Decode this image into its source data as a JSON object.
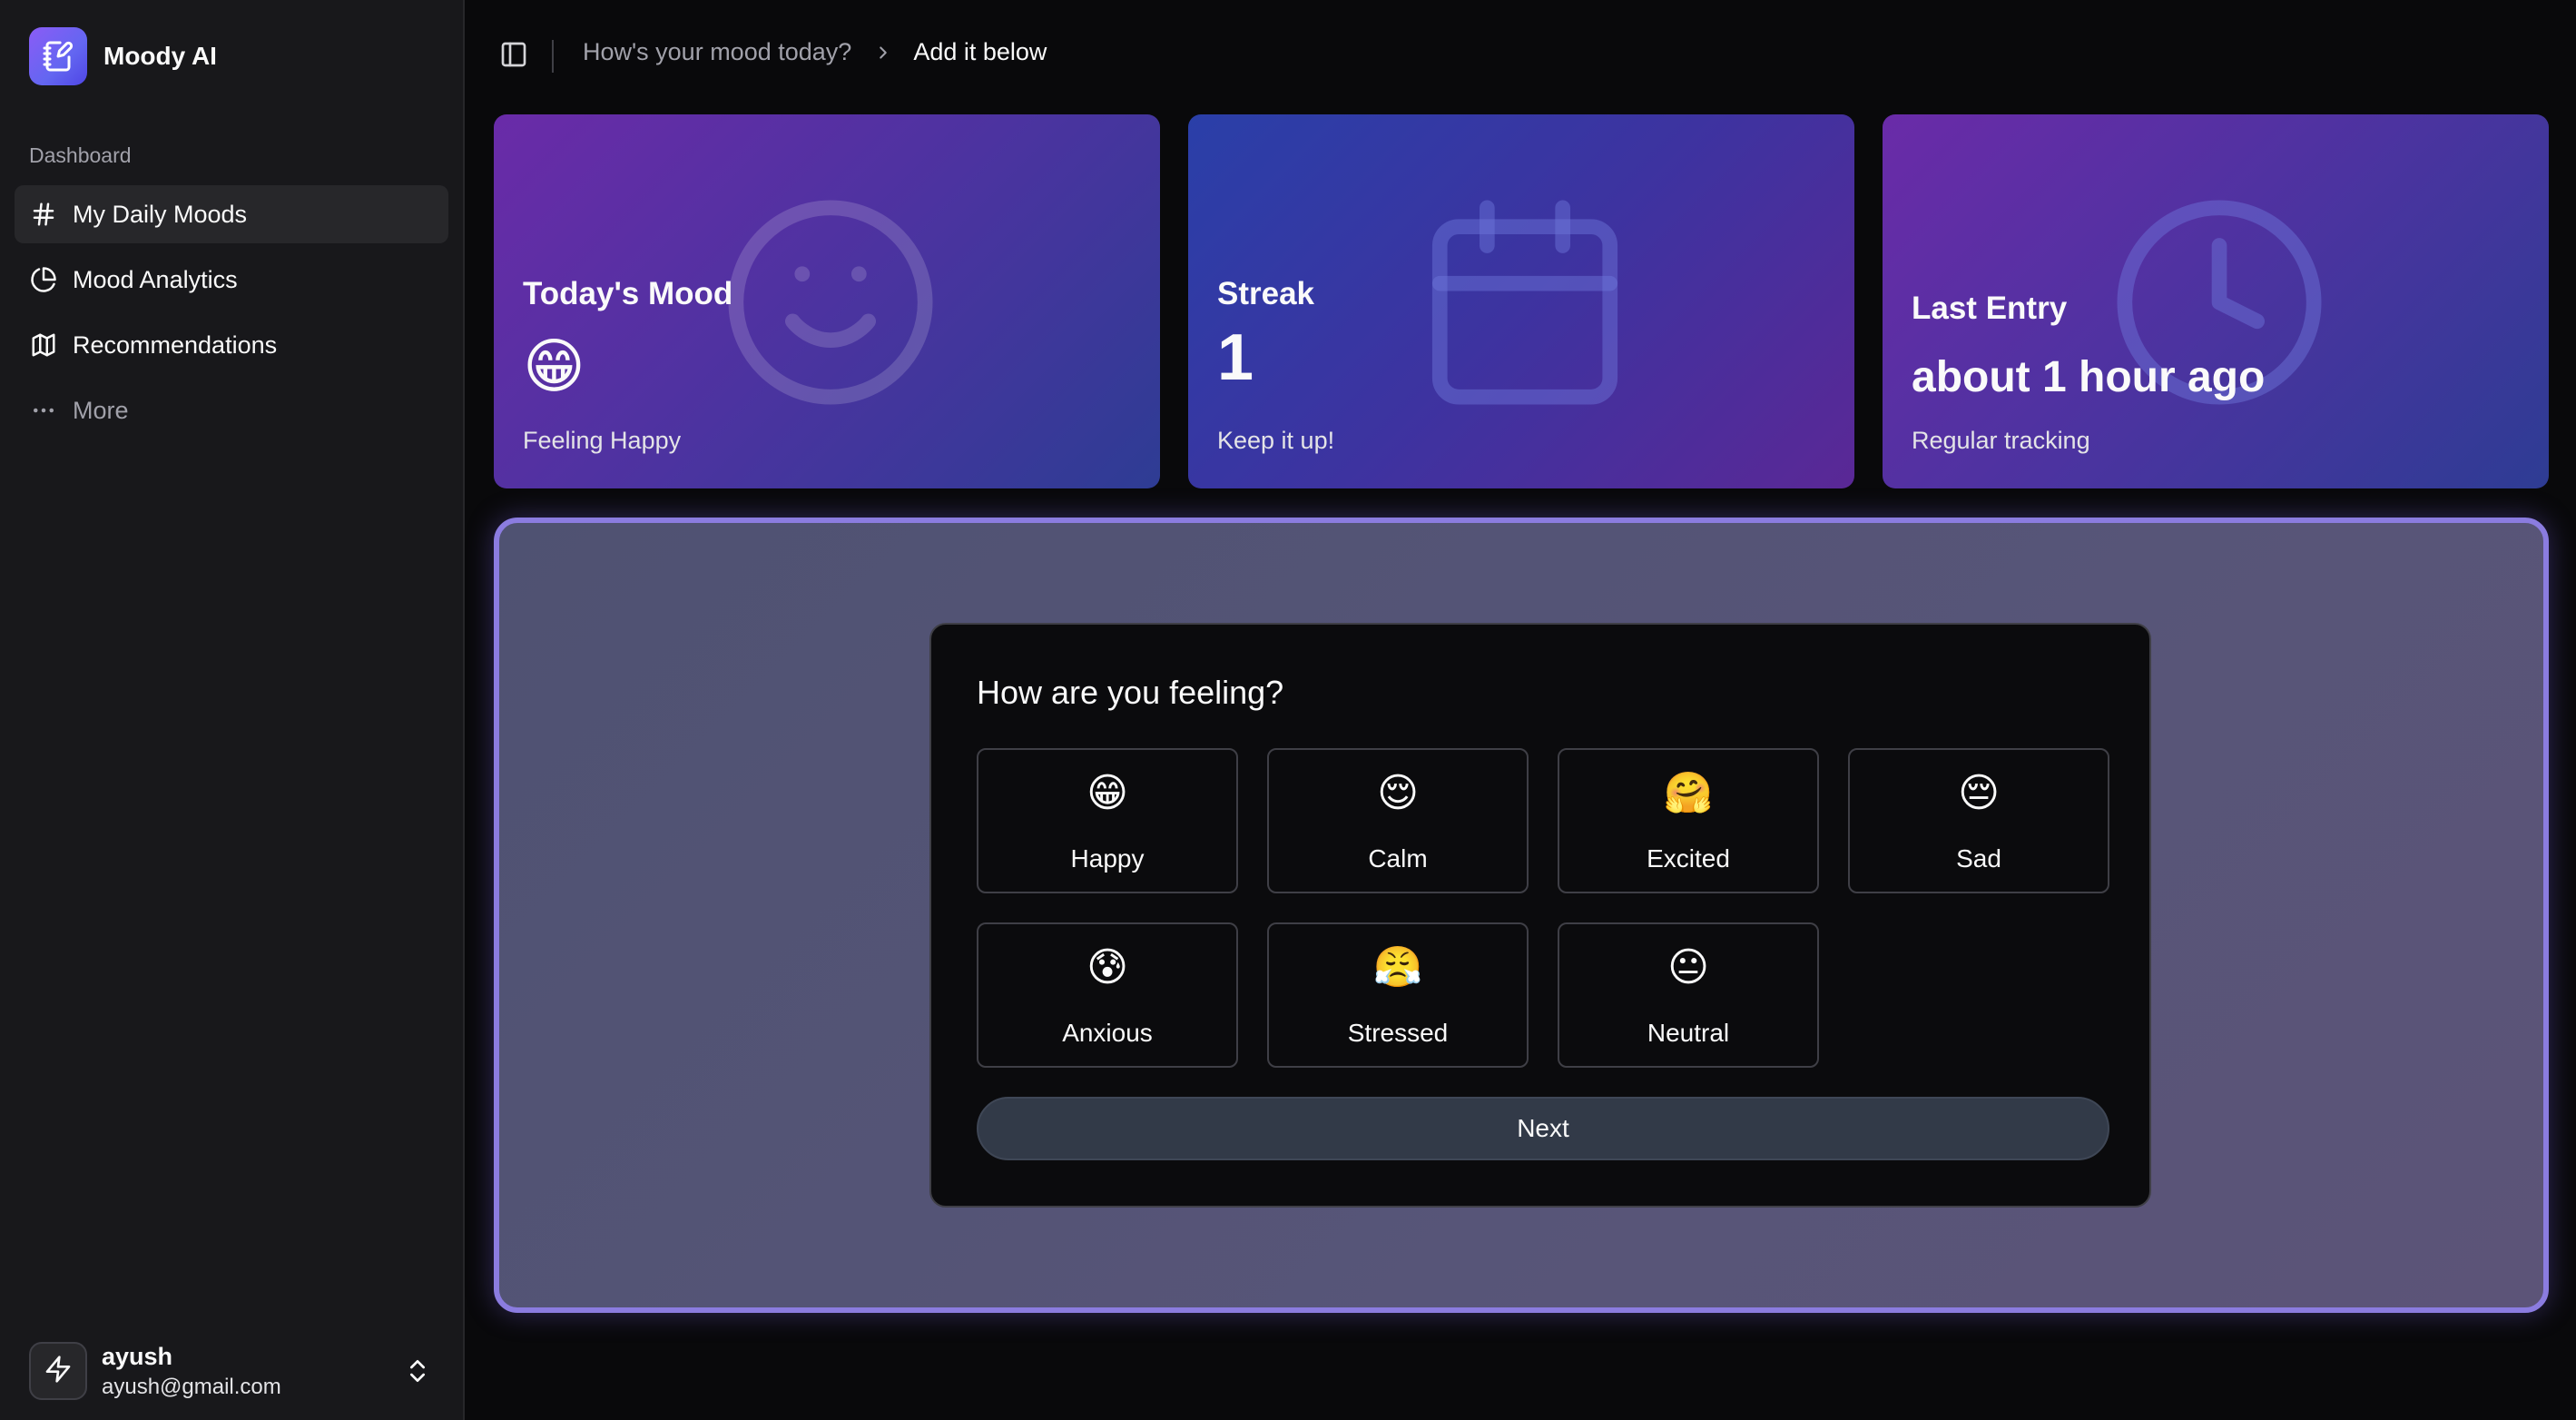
{
  "sidebar": {
    "brand": "Moody AI",
    "group_label": "Dashboard",
    "items": [
      {
        "label": "My Daily Moods",
        "icon": "hash-icon",
        "active": true
      },
      {
        "label": "Mood Analytics",
        "icon": "pie-chart-icon",
        "active": false
      },
      {
        "label": "Recommendations",
        "icon": "map-icon",
        "active": false
      },
      {
        "label": "More",
        "icon": "more-horizontal-icon",
        "active": false
      }
    ],
    "user": {
      "name": "ayush",
      "email": "ayush@gmail.com",
      "icon": "zap-icon"
    }
  },
  "header": {
    "breadcrumb_parent": "How's your mood today?",
    "breadcrumb_current": "Add it below"
  },
  "cards": [
    {
      "title": "Today's Mood",
      "value": "😁",
      "subtitle": "Feeling Happy",
      "bg_icon": "smile-icon"
    },
    {
      "title": "Streak",
      "value": "1",
      "subtitle": "Keep it up!",
      "bg_icon": "calendar-icon"
    },
    {
      "title": "Last Entry",
      "value": "about 1 hour ago",
      "subtitle": "Regular tracking",
      "bg_icon": "clock-icon"
    }
  ],
  "form": {
    "title": "How are you feeling?",
    "moods": [
      {
        "emoji": "😁",
        "label": "Happy"
      },
      {
        "emoji": "😌",
        "label": "Calm"
      },
      {
        "emoji": "🤗",
        "label": "Excited"
      },
      {
        "emoji": "😔",
        "label": "Sad"
      },
      {
        "emoji": "😰",
        "label": "Anxious"
      },
      {
        "emoji": "😤",
        "label": "Stressed"
      },
      {
        "emoji": "😐",
        "label": "Neutral"
      }
    ],
    "next_label": "Next"
  },
  "colors": {
    "accent_border": "#8b7ce0",
    "card_purple": "#6a2ba8",
    "card_blue": "#2e3c94",
    "sidebar_bg": "#18181b"
  }
}
